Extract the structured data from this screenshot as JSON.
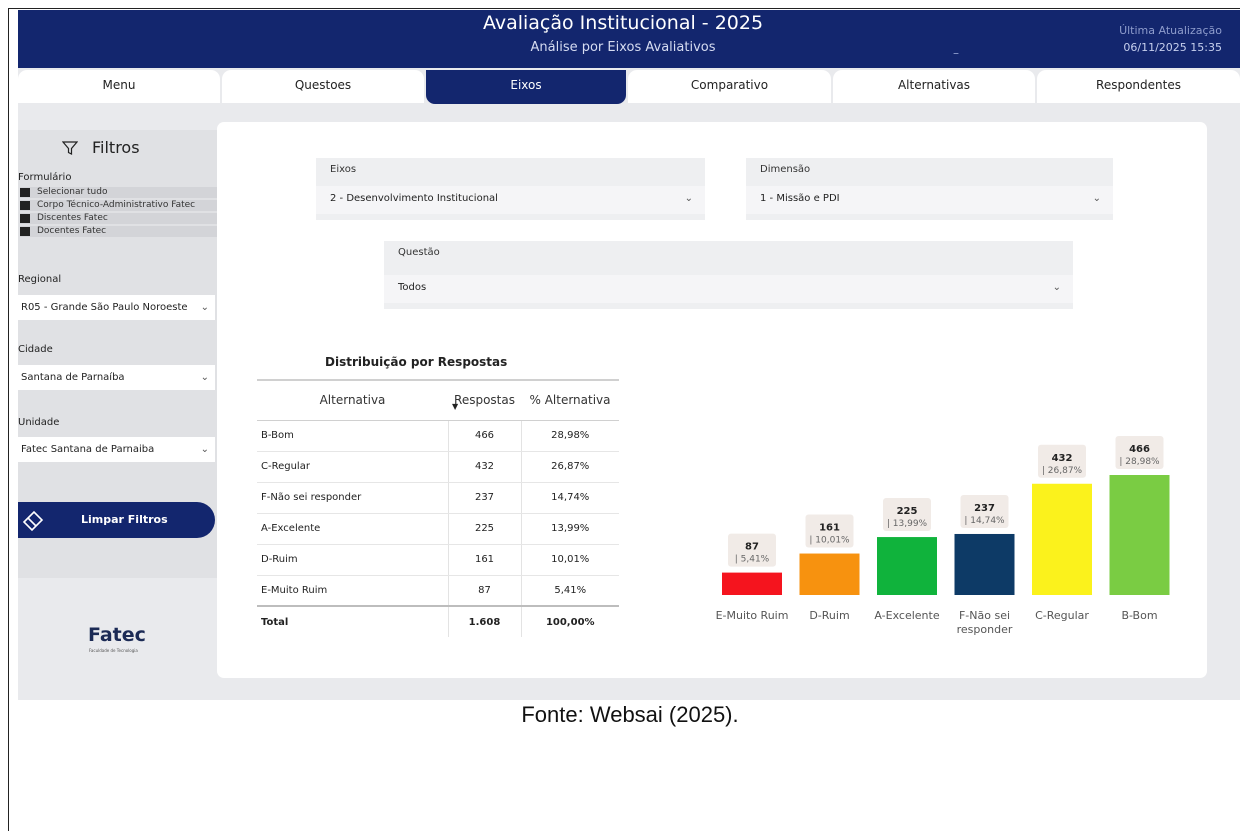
{
  "header": {
    "title": "Avaliação Institucional - 2025",
    "subtitle": "Análise por Eixos Avaliativos",
    "update_label": "Última Atualização",
    "update_date": "06/11/2025 15:35",
    "dash": "–"
  },
  "tabs": [
    {
      "label": "Menu"
    },
    {
      "label": "Questoes"
    },
    {
      "label": "Eixos"
    },
    {
      "label": "Comparativo"
    },
    {
      "label": "Alternativas"
    },
    {
      "label": "Respondentes"
    }
  ],
  "sidebar": {
    "filters_title": "Filtros",
    "formulario_label": "Formulário",
    "formulario_options": [
      "Selecionar tudo",
      "Corpo Técnico-Administrativo Fatec",
      "Discentes Fatec",
      "Docentes Fatec"
    ],
    "regional_label": "Regional",
    "regional_value": "R05 - Grande São Paulo Noroeste",
    "cidade_label": "Cidade",
    "cidade_value": "Santana de Parnaíba",
    "unidade_label": "Unidade",
    "unidade_value": "Fatec Santana de Parnaiba",
    "clear_button": "Limpar Filtros",
    "logo_text": "Fatec",
    "logo_subtext": "Faculdade de Tecnologia"
  },
  "selectors": {
    "eixos_label": "Eixos",
    "eixos_value": "2 - Desenvolvimento Institucional",
    "dimensao_label": "Dimensão",
    "dimensao_value": "1 - Missão e PDI",
    "questao_label": "Questão",
    "questao_value": "Todos"
  },
  "table": {
    "title": "Distribuição por Respostas",
    "headers": [
      "Alternativa",
      "Respostas",
      "% Alternativa"
    ],
    "rows": [
      [
        "B-Bom",
        "466",
        "28,98%"
      ],
      [
        "C-Regular",
        "432",
        "26,87%"
      ],
      [
        "F-Não sei responder",
        "237",
        "14,74%"
      ],
      [
        "A-Excelente",
        "225",
        "13,99%"
      ],
      [
        "D-Ruim",
        "161",
        "10,01%"
      ],
      [
        "E-Muito Ruim",
        "87",
        "5,41%"
      ]
    ],
    "total": [
      "Total",
      "1.608",
      "100,00%"
    ]
  },
  "chart_data": {
    "type": "bar",
    "categories": [
      "E-Muito Ruim",
      "D-Ruim",
      "A-Excelente",
      "F-Não sei responder",
      "C-Regular",
      "B-Bom"
    ],
    "category_lines": [
      [
        "E-Muito Ruim"
      ],
      [
        "D-Ruim"
      ],
      [
        "A-Excelente"
      ],
      [
        "F-Não sei",
        "responder"
      ],
      [
        "C-Regular"
      ],
      [
        "B-Bom"
      ]
    ],
    "values": [
      87,
      161,
      225,
      237,
      432,
      466
    ],
    "percent_labels": [
      "| 5,41%",
      "| 10,01%",
      "| 13,99%",
      "| 14,74%",
      "| 26,87%",
      "| 28,98%"
    ],
    "colors": [
      "#f5141e",
      "#f7920f",
      "#10b33c",
      "#0d3a66",
      "#fbf21c",
      "#7acc43"
    ],
    "title": "",
    "xlabel": "",
    "ylabel": ""
  },
  "caption": "Fonte: Websai (2025)."
}
